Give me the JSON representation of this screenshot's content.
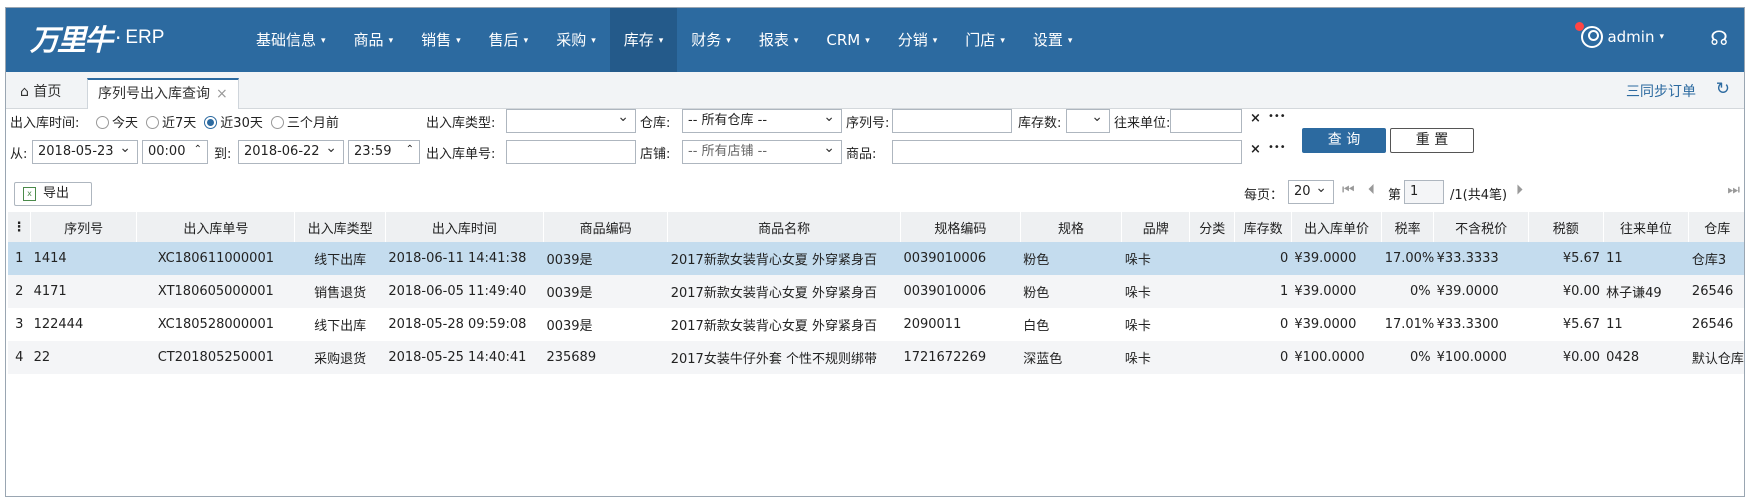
{
  "app": {
    "brand": "万里牛",
    "erp": "ERP"
  },
  "nav": [
    {
      "label": "基础信息",
      "active": false
    },
    {
      "label": "商品",
      "active": false
    },
    {
      "label": "销售",
      "active": false
    },
    {
      "label": "售后",
      "active": false
    },
    {
      "label": "采购",
      "active": false
    },
    {
      "label": "库存",
      "active": true
    },
    {
      "label": "财务",
      "active": false
    },
    {
      "label": "报表",
      "active": false
    },
    {
      "label": "CRM",
      "active": false
    },
    {
      "label": "分销",
      "active": false
    },
    {
      "label": "门店",
      "active": false
    },
    {
      "label": "设置",
      "active": false
    }
  ],
  "user": {
    "name": "admin"
  },
  "tabs": {
    "home": "首页",
    "current": "序列号出入库查询",
    "close": "×"
  },
  "toolbar_right": {
    "sync": "三同步订单"
  },
  "filters": {
    "time_label": "出入库时间:",
    "time_options": [
      "今天",
      "近7天",
      "近30天",
      "三个月前"
    ],
    "time_selected": 2,
    "from_label": "从:",
    "from_date": "2018-05-23",
    "from_time": "00:00",
    "to_label": "到:",
    "to_date": "2018-06-22",
    "to_time": "23:59",
    "type_label": "出入库类型:",
    "type_value": "",
    "order_no_label": "出入库单号:",
    "order_no_value": "",
    "warehouse_label": "仓库:",
    "warehouse_value": "-- 所有仓库 --",
    "shop_label": "店铺:",
    "shop_value": "-- 所有店铺 --",
    "serial_label": "序列号:",
    "serial_value": "",
    "goods_label": "商品:",
    "goods_value": "",
    "stock_label": "库存数:",
    "stock_value": "",
    "partner_label": "往来单位:",
    "partner_value": "",
    "clear_mark": "×",
    "more_mark": "•••",
    "query_btn": "查 询",
    "reset_btn": "重 置"
  },
  "export_btn": "导出",
  "pager": {
    "per_page_label": "每页：",
    "per_page": "20",
    "page_prefix": "第",
    "page": "1",
    "page_suffix": "/1(共4笔)"
  },
  "table": {
    "columns": [
      "序列号",
      "出入库单号",
      "出入库类型",
      "出入库时间",
      "商品编码",
      "商品名称",
      "规格编码",
      "规格",
      "品牌",
      "分类",
      "库存数",
      "出入库单价",
      "税率",
      "不含税价",
      "税额",
      "往来单位",
      "仓库"
    ],
    "rows": [
      {
        "idx": "1",
        "serial": "1414",
        "order": "XC180611000001",
        "type": "线下出库",
        "time": "2018-06-11 14:41:38",
        "code": "0039是",
        "name": "2017新款女装背心女夏 外穿紧身百",
        "spec_code": "0039010006",
        "spec": "粉色",
        "brand": "哚卡",
        "category": "",
        "stock": "0",
        "price": "¥39.0000",
        "tax_rate": "17.00%",
        "net_price": "¥33.3333",
        "tax": "¥5.67",
        "partner": "11",
        "warehouse": "仓库3"
      },
      {
        "idx": "2",
        "serial": "4171",
        "order": "XT180605000001",
        "type": "销售退货",
        "time": "2018-06-05 11:49:40",
        "code": "0039是",
        "name": "2017新款女装背心女夏 外穿紧身百",
        "spec_code": "0039010006",
        "spec": "粉色",
        "brand": "哚卡",
        "category": "",
        "stock": "1",
        "price": "¥39.0000",
        "tax_rate": "0%",
        "net_price": "¥39.0000",
        "tax": "¥0.00",
        "partner": "林子谦49",
        "warehouse": "26546"
      },
      {
        "idx": "3",
        "serial": "122444",
        "order": "XC180528000001",
        "type": "线下出库",
        "time": "2018-05-28 09:59:08",
        "code": "0039是",
        "name": "2017新款女装背心女夏 外穿紧身百",
        "spec_code": "2090011",
        "spec": "白色",
        "brand": "哚卡",
        "category": "",
        "stock": "0",
        "price": "¥39.0000",
        "tax_rate": "17.01%",
        "net_price": "¥33.3300",
        "tax": "¥5.67",
        "partner": "11",
        "warehouse": "26546"
      },
      {
        "idx": "4",
        "serial": "22",
        "order": "CT201805250001",
        "type": "采购退货",
        "time": "2018-05-25 14:40:41",
        "code": "235689",
        "name": "2017女装牛仔外套 个性不规则绑带",
        "spec_code": "1721672269",
        "spec": "深蓝色",
        "brand": "哚卡",
        "category": "",
        "stock": "0",
        "price": "¥100.0000",
        "tax_rate": "0%",
        "net_price": "¥100.0000",
        "tax": "¥0.00",
        "partner": "0428",
        "warehouse": "默认仓库"
      }
    ]
  }
}
